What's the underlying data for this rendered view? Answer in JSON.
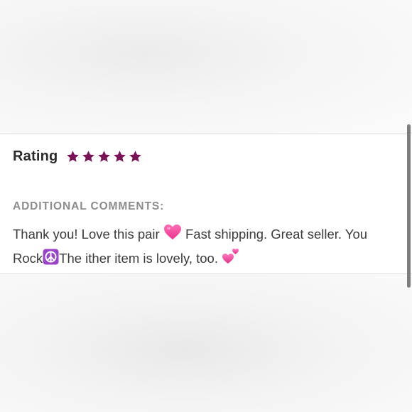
{
  "rating": {
    "label": "Rating",
    "stars": 5,
    "max_stars": 5,
    "star_color": "#7a1257"
  },
  "comments": {
    "heading": "ADDITIONAL COMMENTS:",
    "part1": "Thank you! Love this pair ",
    "part2": " Fast shipping. Great seller. You Rock",
    "part3": "The ither item is lovely, too. ",
    "emojis": [
      "pink-heart-icon",
      "peace-symbol-icon",
      "two-hearts-icon"
    ]
  }
}
